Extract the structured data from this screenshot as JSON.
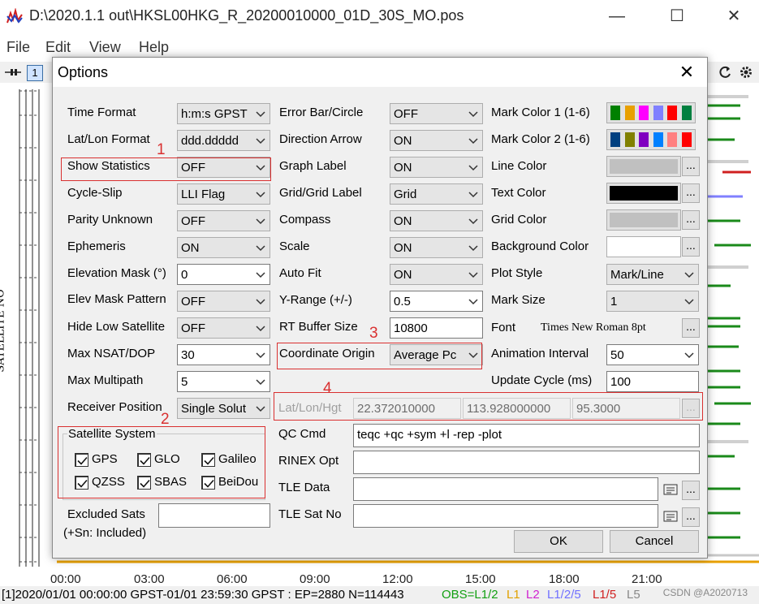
{
  "window": {
    "title": "D:\\2020.1.1 out\\HKSL00HKG_R_20200010000_01D_30S_MO.pos",
    "minimize": "—",
    "maximize": "☐",
    "close": "✕"
  },
  "menu": [
    "File",
    "Edit",
    "View",
    "Help"
  ],
  "toolbar": {
    "page": "1"
  },
  "plot": {
    "y_label": "SATELLITE NO",
    "x_ticks": [
      "00:00",
      "03:00",
      "06:00",
      "09:00",
      "12:00",
      "15:00",
      "18:00",
      "21:00"
    ]
  },
  "status": {
    "left": "[1]2020/01/01 00:00:00 GPST-01/01 23:59:30 GPST : EP=2880 N=114443",
    "obs": "OBS=L1/2",
    "l1": "L1",
    "l2": "L2",
    "l125": "L1/2/5",
    "l15": "L1/5",
    "l5": "L5",
    "colors": {
      "obs": "#12a012",
      "l1": "#e0a000",
      "l2": "#d020d0",
      "l125": "#7070ff",
      "l15": "#d02020",
      "l5": "#888888"
    }
  },
  "watermark": "CSDN @A2020713",
  "dialog": {
    "title": "Options",
    "close": "✕",
    "col1": [
      {
        "label": "Time Format",
        "value": "h:m:s GPST"
      },
      {
        "label": "Lat/Lon Format",
        "value": "ddd.ddddd"
      },
      {
        "label": "Show Statistics",
        "value": "OFF"
      },
      {
        "label": "Cycle-Slip",
        "value": "LLI Flag"
      },
      {
        "label": "Parity Unknown",
        "value": "OFF"
      },
      {
        "label": "Ephemeris",
        "value": "ON"
      },
      {
        "label": "Elevation Mask (°)",
        "value": "0"
      },
      {
        "label": "Elev Mask Pattern",
        "value": "OFF"
      },
      {
        "label": "Hide Low Satellite",
        "value": "OFF"
      },
      {
        "label": "Max NSAT/DOP",
        "value": "30"
      },
      {
        "label": "Max Multipath",
        "value": "5"
      },
      {
        "label": "Receiver Position",
        "value": "Single Solut"
      }
    ],
    "col2": [
      {
        "label": "Error Bar/Circle",
        "value": "OFF"
      },
      {
        "label": "Direction Arrow",
        "value": "ON"
      },
      {
        "label": "Graph Label",
        "value": "ON"
      },
      {
        "label": "Grid/Grid Label",
        "value": "Grid"
      },
      {
        "label": "Compass",
        "value": "ON"
      },
      {
        "label": "Scale",
        "value": "ON"
      },
      {
        "label": "Auto Fit",
        "value": "ON"
      },
      {
        "label": "Y-Range (+/-)",
        "value": "0.5"
      },
      {
        "label": "RT Buffer Size",
        "value": "10800"
      },
      {
        "label": "Coordinate Origin",
        "value": "Average Pc"
      }
    ],
    "col3": {
      "mark_color_1": "Mark Color 1 (1-6)",
      "mark_colors_1": [
        "#008000",
        "#e8a000",
        "#ff00ff",
        "#8080ff",
        "#ff0000",
        "#008040"
      ],
      "mark_color_2": "Mark Color 2 (1-6)",
      "mark_colors_2": [
        "#004080",
        "#808000",
        "#8000c0",
        "#0080ff",
        "#ff8080",
        "#ff0000"
      ],
      "line_color": "Line Color",
      "line_color_value": "#c0c0c0",
      "text_color": "Text Color",
      "text_color_value": "#000000",
      "grid_color": "Grid Color",
      "grid_color_value": "#c0c0c0",
      "background_color": "Background Color",
      "background_color_value": "#ffffff",
      "plot_style": "Plot Style",
      "plot_style_value": "Mark/Line",
      "mark_size": "Mark Size",
      "mark_size_value": "1",
      "font": "Font",
      "font_value": "Times New Roman 8pt",
      "animation_interval": "Animation Interval",
      "animation_interval_value": "50",
      "update_cycle": "Update Cycle (ms)",
      "update_cycle_value": "100"
    },
    "ellipsis": "...",
    "latlon": {
      "label": "Lat/Lon/Hgt",
      "lat": "22.372010000",
      "lon": "113.928000000",
      "hgt": "95.3000"
    },
    "satsys": {
      "title": "Satellite System",
      "items": [
        "GPS",
        "GLO",
        "Galileo",
        "QZSS",
        "SBAS",
        "BeiDou"
      ]
    },
    "excluded": {
      "label1": "Excluded Sats",
      "label2": "(+Sn: Included)",
      "value": ""
    },
    "qc_cmd": {
      "label": "QC Cmd",
      "value": "teqc +qc +sym +l -rep -plot"
    },
    "rinex_opt": {
      "label": "RINEX Opt",
      "value": ""
    },
    "tle_data": {
      "label": "TLE Data",
      "value": ""
    },
    "tle_satno": {
      "label": "TLE Sat No",
      "value": ""
    },
    "ok": "OK",
    "cancel": "Cancel",
    "annotations": [
      "1",
      "2",
      "3",
      "4"
    ]
  }
}
